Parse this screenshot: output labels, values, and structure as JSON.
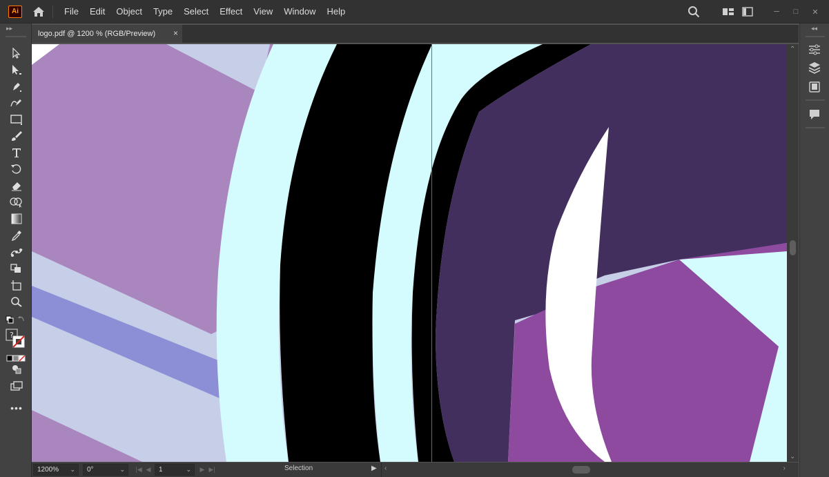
{
  "app": {
    "logo_text": "Ai",
    "logo_color": "#ff9a00"
  },
  "menu": {
    "items": [
      "File",
      "Edit",
      "Object",
      "Type",
      "Select",
      "Effect",
      "View",
      "Window",
      "Help"
    ]
  },
  "document": {
    "tab_title": "logo.pdf @ 1200 % (RGB/Preview)",
    "close_glyph": "×"
  },
  "status": {
    "zoom": "1200%",
    "rotation": "0°",
    "artboard": "1",
    "current_tool": "Selection"
  },
  "tools": [
    "selection-tool",
    "direct-selection-tool",
    "pen-tool",
    "curvature-tool",
    "rectangle-tool",
    "paintbrush-tool",
    "type-tool",
    "rotate-tool",
    "eraser-tool",
    "shape-builder-tool",
    "gradient-tool",
    "eyedropper-tool",
    "puppet-warp-tool",
    "free-transform-tool",
    "artboard-tool",
    "zoom-tool"
  ],
  "dock_panels": [
    "properties-icon",
    "layers-icon",
    "libraries-icon",
    "comments-icon"
  ],
  "artwork_colors": {
    "light_cyan": "#d4fbfe",
    "black": "#000000",
    "dark_purple": "#432f5e",
    "mid_purple": "#8e4a9e",
    "lilac": "#a986bd",
    "lavender": "#c7cfe8",
    "periwinkle": "#8c8fd6",
    "white": "#ffffff"
  }
}
